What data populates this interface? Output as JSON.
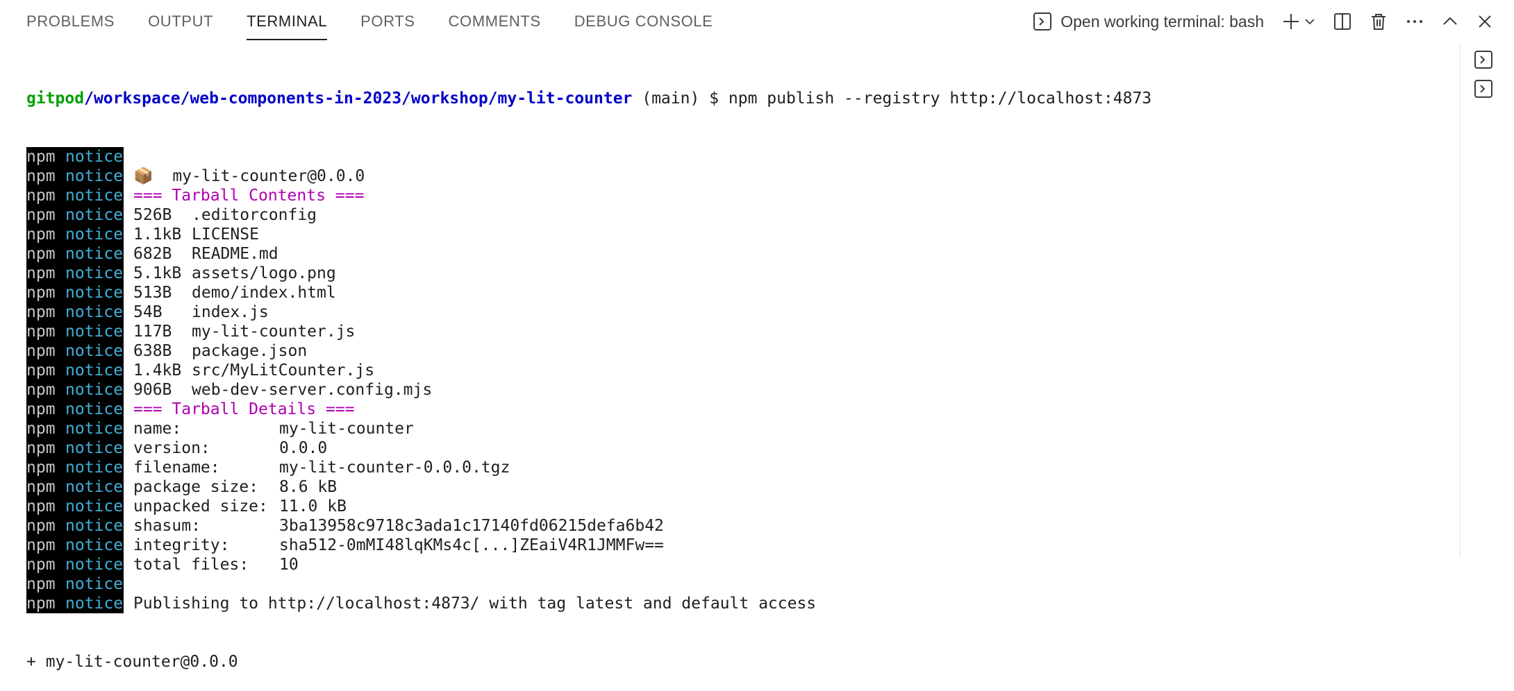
{
  "panel": {
    "tabs": [
      {
        "label": "PROBLEMS"
      },
      {
        "label": "OUTPUT"
      },
      {
        "label": "TERMINAL"
      },
      {
        "label": "PORTS"
      },
      {
        "label": "COMMENTS"
      },
      {
        "label": "DEBUG CONSOLE"
      }
    ],
    "active_tab": "TERMINAL",
    "open_terminal_label": "Open working terminal: bash"
  },
  "terminal": {
    "prompt": {
      "user": "gitpod",
      "path": "/workspace/web-components-in-2023/workshop/my-lit-counter",
      "branch": " (main) $ ",
      "command": "npm publish --registry http://localhost:4873"
    },
    "npm_tag": "npm",
    "notice_tag": "notice",
    "package_line": "📦  my-lit-counter@0.0.0",
    "contents_header": "=== Tarball Contents ===",
    "files": [
      {
        "size": "526B",
        "name": ".editorconfig"
      },
      {
        "size": "1.1kB",
        "name": "LICENSE"
      },
      {
        "size": "682B",
        "name": "README.md"
      },
      {
        "size": "5.1kB",
        "name": "assets/logo.png"
      },
      {
        "size": "513B",
        "name": "demo/index.html"
      },
      {
        "size": "54B",
        "name": "index.js"
      },
      {
        "size": "117B",
        "name": "my-lit-counter.js"
      },
      {
        "size": "638B",
        "name": "package.json"
      },
      {
        "size": "1.4kB",
        "name": "src/MyLitCounter.js"
      },
      {
        "size": "906B",
        "name": "web-dev-server.config.mjs"
      }
    ],
    "details_header": "=== Tarball Details ===",
    "details": [
      {
        "key": "name:",
        "value": "my-lit-counter"
      },
      {
        "key": "version:",
        "value": "0.0.0"
      },
      {
        "key": "filename:",
        "value": "my-lit-counter-0.0.0.tgz"
      },
      {
        "key": "package size:",
        "value": "8.6 kB"
      },
      {
        "key": "unpacked size:",
        "value": "11.0 kB"
      },
      {
        "key": "shasum:",
        "value": "3ba13958c9718c3ada1c17140fd06215defa6b42"
      },
      {
        "key": "integrity:",
        "value": "sha512-0mMI48lqKMs4c[...]ZEaiV4R1JMMFw=="
      },
      {
        "key": "total files:",
        "value": "10"
      }
    ],
    "publishing_line": "Publishing to http://localhost:4873/ with tag latest and default access",
    "result_line": "+ my-lit-counter@0.0.0"
  }
}
